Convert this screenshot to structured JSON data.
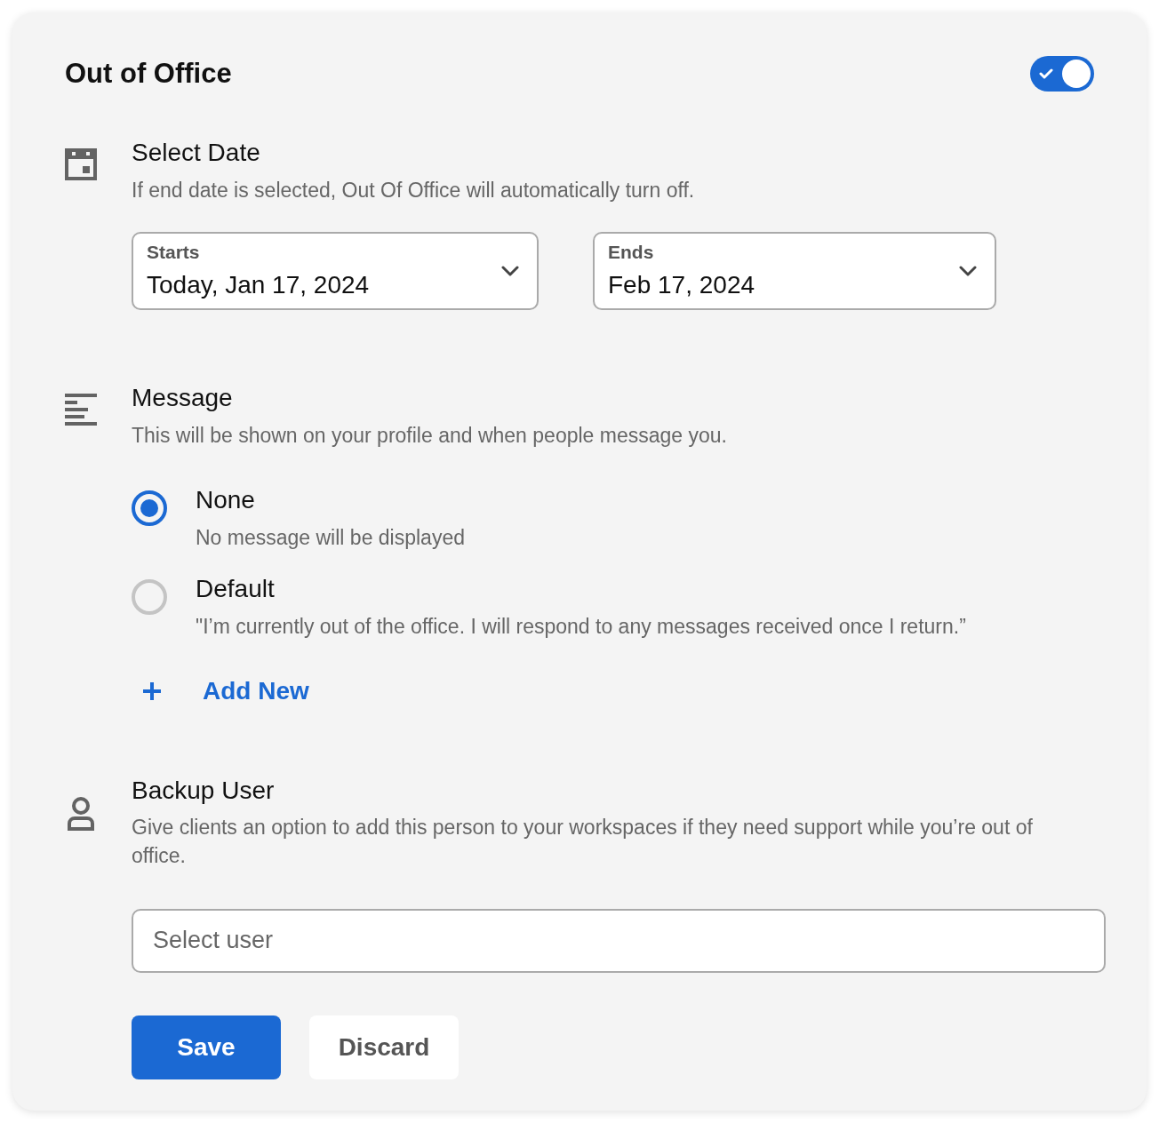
{
  "title": "Out of Office",
  "enabled": true,
  "date_section": {
    "title": "Select Date",
    "description": "If end date is selected,  Out Of Office will automatically turn off.",
    "fields": [
      {
        "label": "Starts",
        "value": "Today, Jan 17, 2024"
      },
      {
        "label": "Ends",
        "value": "Feb 17, 2024"
      }
    ]
  },
  "message_section": {
    "title": "Message",
    "description": "This will be shown on your profile and when people message you.",
    "options": [
      {
        "label": "None",
        "description": "No message will be displayed",
        "selected": true
      },
      {
        "label": "Default",
        "description": "\"I’m currently out of the office. I will respond to any messages received once I return.”",
        "selected": false
      }
    ],
    "add_link": "Add New"
  },
  "backup_section": {
    "title": "Backup User",
    "description": "Give clients an option to add this person to your workspaces if they need support while you’re out of office.",
    "placeholder": "Select user"
  },
  "buttons": [
    {
      "label": "Save",
      "kind": "primary"
    },
    {
      "label": "Discard",
      "kind": "secondary"
    }
  ]
}
